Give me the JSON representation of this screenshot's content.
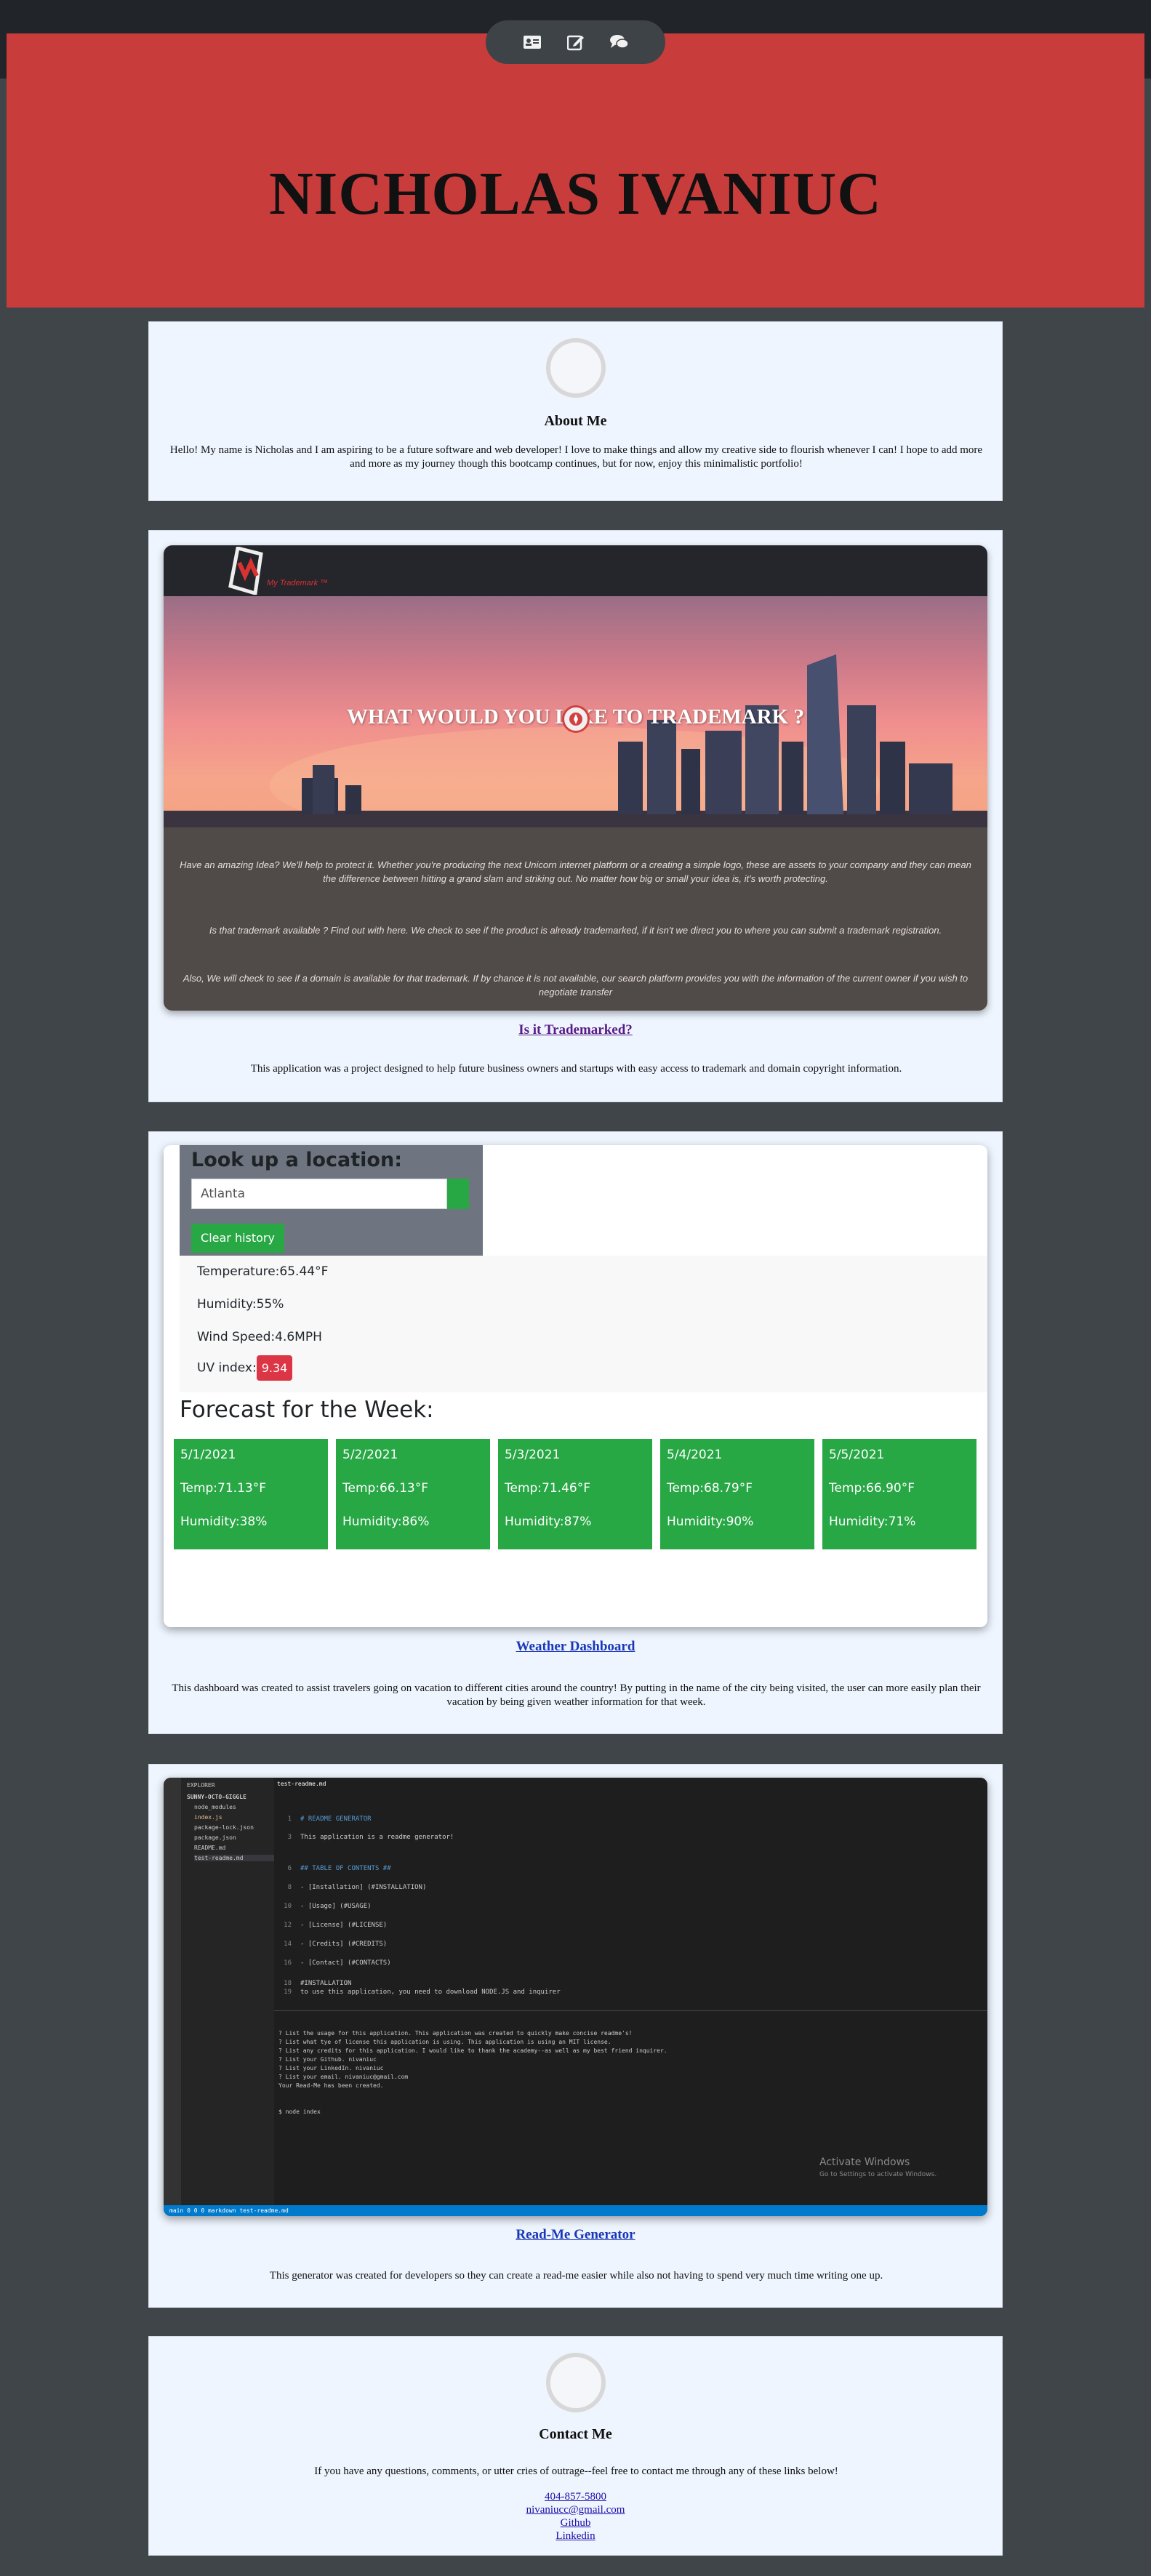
{
  "nav": {
    "items": [
      {
        "icon": "id-card-icon"
      },
      {
        "icon": "edit-icon"
      },
      {
        "icon": "comments-icon"
      }
    ]
  },
  "header": {
    "name": "NICHOLAS IVANIUC"
  },
  "about": {
    "title": "About Me",
    "text": "Hello! My name is Nicholas and I am aspiring to be a future software and web developer! I love to make things and allow my creative side to flourish whenever I can! I hope to add more and more as my journey though this bootcamp continues, but for now, enjoy this minimalistic portfolio!"
  },
  "projects": [
    {
      "link": "Is it Trademarked?",
      "description": "This application was a project designed to help future business owners and startups with easy access to trademark and domain copyright information.",
      "preview": {
        "logo_text": "My Trademark ™",
        "hero": "WHAT WOULD YOU LIKE TO TRADEMARK ?",
        "p1": "Have an amazing Idea? We'll help to protect it. Whether you're producing the next Unicorn internet platform or a creating a simple logo, these are assets to your company and they can mean the difference between hitting a grand slam and striking out. No matter how big or small your idea is, it's worth protecting.",
        "p2": "Is that trademark available ? Find out with here. We check to see if the product is already trademarked, if it isn't we direct you to where you can submit a trademark registration.",
        "p3": "Also, We will check to see if a domain is available for that trademark. If by chance it is not available, our search platform provides you with the information of the current owner if you wish to negotiate transfer"
      }
    },
    {
      "link": "Weather Dashboard",
      "description": "This dashboard was created to assist travelers going on vacation to different cities around the country! By putting in the name of the city being visited, the user can more easily plan their vacation by being given weather information for that week.",
      "preview": {
        "search_title": "Look up a location:",
        "search_value": "Atlanta",
        "clear_label": "Clear history",
        "temperature": "Temperature:65.44°F",
        "humidity": "Humidity:55%",
        "wind": "Wind Speed:4.6MPH",
        "uv_label": "UV index:",
        "uv_value": "9.34",
        "forecast_title": "Forecast for the Week:",
        "forecast": [
          {
            "date": "5/1/2021",
            "temp": "Temp:71.13°F",
            "humidity": "Humidity:38%"
          },
          {
            "date": "5/2/2021",
            "temp": "Temp:66.13°F",
            "humidity": "Humidity:86%"
          },
          {
            "date": "5/3/2021",
            "temp": "Temp:71.46°F",
            "humidity": "Humidity:87%"
          },
          {
            "date": "5/4/2021",
            "temp": "Temp:68.79°F",
            "humidity": "Humidity:90%"
          },
          {
            "date": "5/5/2021",
            "temp": "Temp:66.90°F",
            "humidity": "Humidity:71%"
          }
        ]
      }
    },
    {
      "link": "Read-Me Generator",
      "description": "This generator was created for developers so they can create a read-me easier while also not having to spend very much time writing one up.",
      "preview": {
        "tab": "test-readme.md",
        "explorer": "EXPLORER",
        "folder": "SUNNY-OCTO-GIGGLE",
        "files": [
          "node_modules",
          "index.js",
          "package-lock.json",
          "package.json",
          "README.md",
          "test-readme.md"
        ],
        "code": [
          "# README GENERATOR",
          "",
          "This application is a readme generator!",
          "",
          "",
          "## TABLE OF CONTENTS ##",
          "",
          "- [Installation] (#INSTALLATION)",
          "",
          "- [Usage] (#USAGE)",
          "",
          "- [License] (#LICENSE)",
          "",
          "- [Credits] (#CREDITS)",
          "",
          "- [Contact] (#CONTACTS)",
          "",
          "#INSTALLATION",
          "to use this application, you need to download NODE.JS and inquirer"
        ],
        "terminal": [
          "? List the usage for this application. This application was created to quickly make concise readme's!",
          "? List what tye of license this application is using. This application is using an MIT license.",
          "? List any credits for this application. I would like to thank the academy--as well as my best friend inquirer.",
          "? List your Github. nivaniuc",
          "? List your LinkedIn. nivaniuc",
          "? List your email. nivaniuc@gmail.com",
          "Your Read-Me has been created.",
          "",
          "$ node index"
        ],
        "watermark": "Activate Windows",
        "watermark_sub": "Go to Settings to activate Windows.",
        "status": "main    0  0  0    markdown    test-readme.md"
      }
    }
  ],
  "contact": {
    "title": "Contact Me",
    "text": "If you have any questions, comments, or utter cries of outrage--feel free to contact me through any of these links below!",
    "links": [
      "404-857-5800",
      "nivaniucc@gmail.com",
      "Github",
      "Linkedin"
    ]
  },
  "colors": {
    "nav": "#212529",
    "header": "#c93c3c",
    "page": "#3f4549",
    "card": "#eef5fe",
    "weather_green": "#28a745",
    "uv_red": "#dc3545"
  }
}
